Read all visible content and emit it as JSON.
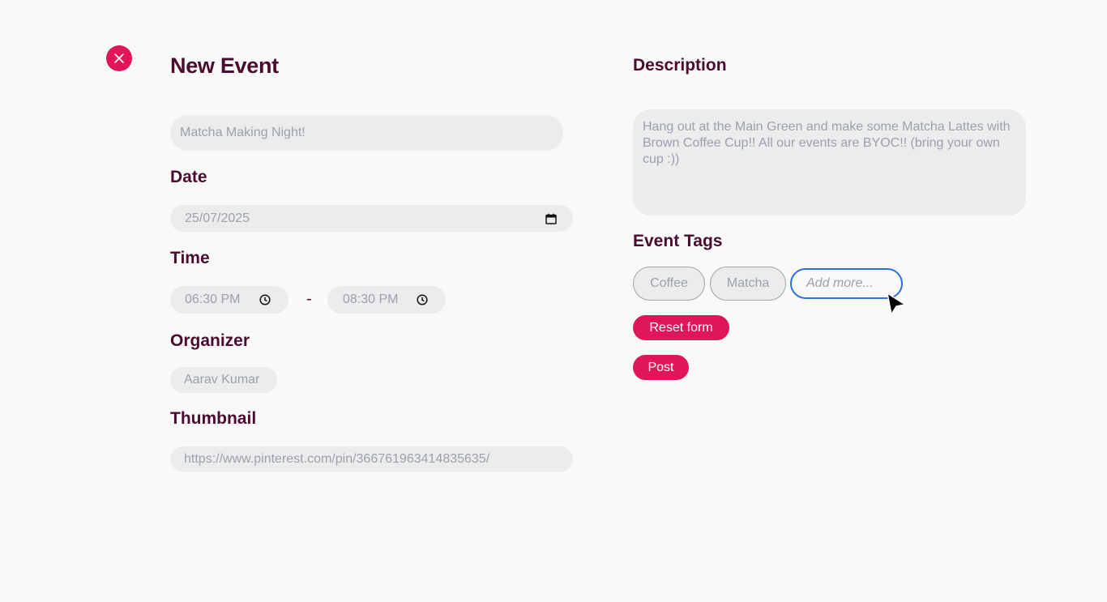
{
  "form": {
    "title": "New Event",
    "event_name_value": "Matcha Making Night!",
    "date_label": "Date",
    "date_value": "25/07/2025",
    "time_label": "Time",
    "start_time_value": "06:30 PM",
    "time_separator": "-",
    "end_time_value": "08:30 PM",
    "organizer_label": "Organizer",
    "organizer_value": "Aarav Kumar",
    "thumbnail_label": "Thumbnail",
    "thumbnail_value": "https://www.pinterest.com/pin/366761963414835635/"
  },
  "details": {
    "description_label": "Description",
    "description_value": "Hang out at the Main Green and make some Matcha Lattes with Brown Coffee Cup!! All our events are BYOC!! (bring your own cup :))",
    "tags_label": "Event Tags",
    "tags": [
      "Coffee",
      "Matcha"
    ],
    "tag_input_placeholder": "Add more..."
  },
  "actions": {
    "reset_label": "Reset form",
    "post_label": "Post"
  },
  "icons": {
    "close": "close-icon",
    "calendar": "calendar-icon",
    "clock": "clock-icon",
    "cursor": "mouse-pointer-icon"
  },
  "colors": {
    "accent": "#e0155a",
    "heading": "#4a0b2f",
    "field_bg": "#ececec",
    "placeholder": "#9aa0ad",
    "focus_border": "#2e6fd8",
    "background": "#f9f9f9"
  }
}
